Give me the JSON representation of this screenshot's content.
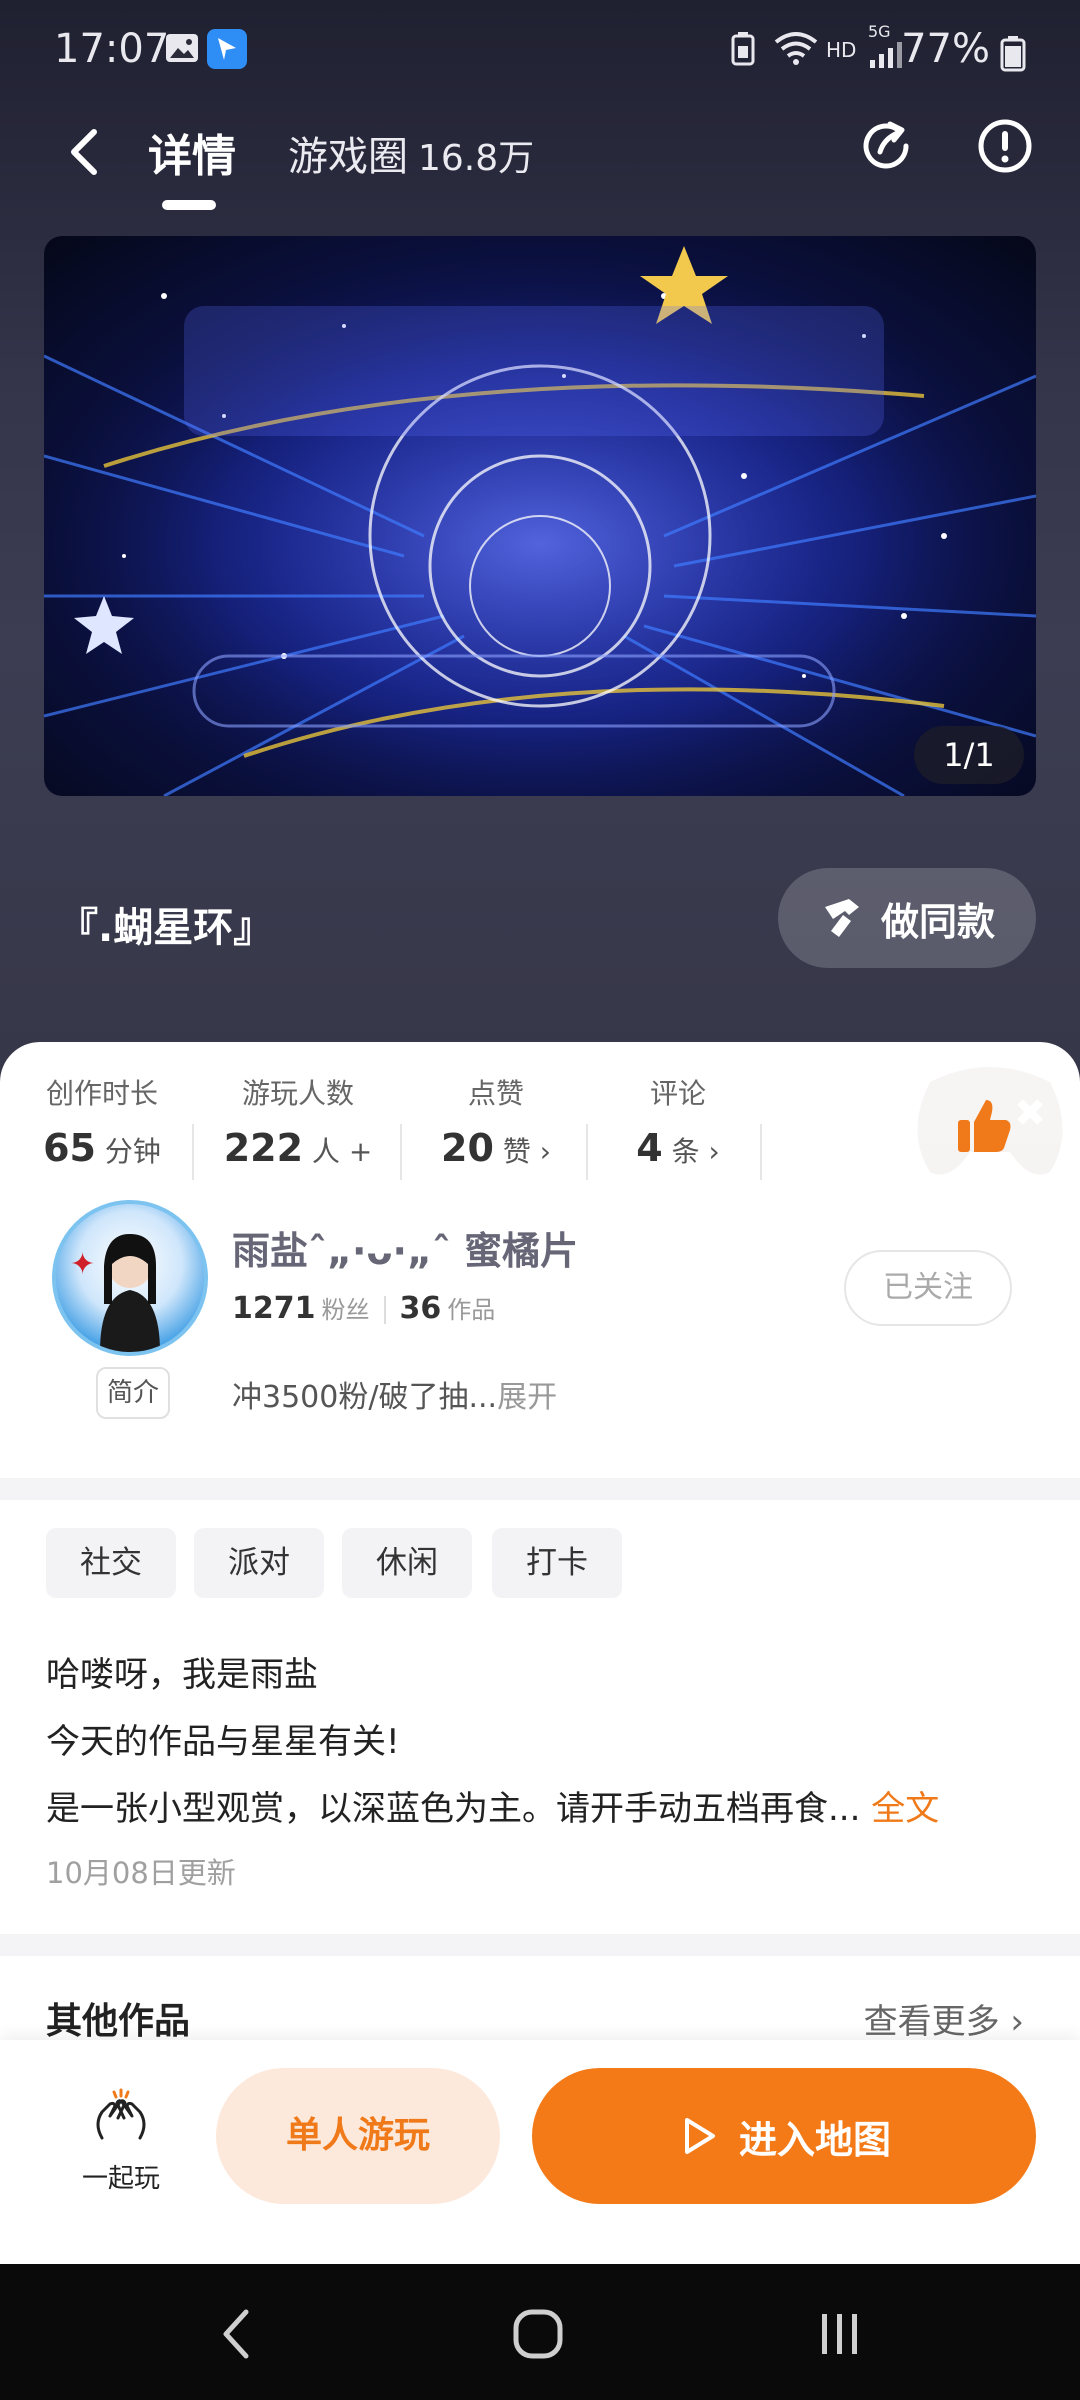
{
  "status_bar": {
    "time": "17:07",
    "network": "HD",
    "network_gen": "5G",
    "battery": "77%"
  },
  "nav": {
    "tab_detail": "详情",
    "tab_circle": "游戏圈",
    "tab_circle_count": "16.8万",
    "icons": [
      "back-icon",
      "share-icon",
      "report-icon"
    ]
  },
  "banner": {
    "counter": "1/1"
  },
  "map": {
    "title": "『.蝴星环』",
    "same_button": "做同款"
  },
  "stats": [
    {
      "label": "创作时长",
      "value": "65",
      "unit": "分钟"
    },
    {
      "label": "游玩人数",
      "value": "222",
      "unit": "人 +"
    },
    {
      "label": "点赞",
      "value": "20",
      "unit": "赞 ›"
    },
    {
      "label": "评论",
      "value": "4",
      "unit": "条 ›"
    }
  ],
  "author": {
    "name": "雨盐ˆ„·ᴗ·„ˆ 蜜橘片",
    "fans_count": "1271",
    "fans_label": "粉丝",
    "works_count": "36",
    "works_label": "作品",
    "intro_tag": "简介",
    "bio": "冲3500粉/破了抽...",
    "bio_more": "展开",
    "follow_button": "已关注"
  },
  "tags": [
    "社交",
    "派对",
    "休闲",
    "打卡"
  ],
  "description": {
    "line1": "哈喽呀，我是雨盐",
    "line2": "今天的作品与星星有关!",
    "line3": "是一张小型观赏，以深蓝色为主。请开手动五档再食...",
    "full_text": "全文",
    "updated": "10月08日更新"
  },
  "other_works": {
    "title": "其他作品",
    "see_more": "查看更多 ›"
  },
  "actions": {
    "play_together": "一起玩",
    "solo_play": "单人游玩",
    "enter_map": "进入地图"
  },
  "colors": {
    "accent": "#f47a18",
    "accent_light": "#fde9dc",
    "header_bg": "#34344a"
  }
}
